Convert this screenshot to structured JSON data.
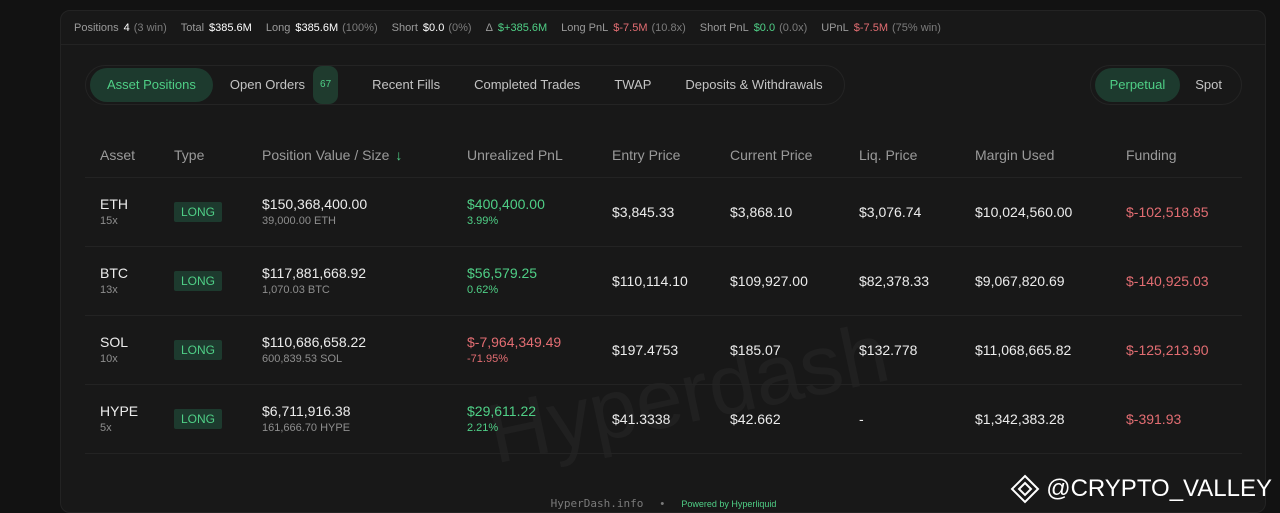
{
  "stats": [
    {
      "label": "Positions",
      "value": "4",
      "sub": "(3 win)",
      "tone": "plain"
    },
    {
      "label": "Total",
      "value": "$385.6M",
      "sub": "",
      "tone": "plain"
    },
    {
      "label": "Long",
      "value": "$385.6M",
      "sub": "(100%)",
      "tone": "plain"
    },
    {
      "label": "Short",
      "value": "$0.0",
      "sub": "(0%)",
      "tone": "plain"
    },
    {
      "label": "Δ",
      "value": "$+385.6M",
      "sub": "",
      "tone": "pos"
    },
    {
      "label": "Long PnL",
      "value": "$-7.5M",
      "sub": "(10.8x)",
      "tone": "neg"
    },
    {
      "label": "Short PnL",
      "value": "$0.0",
      "sub": "(0.0x)",
      "tone": "pos"
    },
    {
      "label": "UPnL",
      "value": "$-7.5M",
      "sub": "(75% win)",
      "tone": "neg"
    }
  ],
  "tabs": [
    {
      "label": "Asset Positions",
      "badge": "",
      "active": true
    },
    {
      "label": "Open Orders",
      "badge": "67",
      "active": false
    },
    {
      "label": "Recent Fills",
      "badge": "",
      "active": false
    },
    {
      "label": "Completed Trades",
      "badge": "",
      "active": false
    },
    {
      "label": "TWAP",
      "badge": "",
      "active": false
    },
    {
      "label": "Deposits & Withdrawals",
      "badge": "",
      "active": false
    }
  ],
  "market_toggle": [
    {
      "label": "Perpetual",
      "active": true
    },
    {
      "label": "Spot",
      "active": false
    }
  ],
  "columns": [
    "Asset",
    "Type",
    "Position Value / Size",
    "Unrealized PnL",
    "Entry Price",
    "Current Price",
    "Liq. Price",
    "Margin Used",
    "Funding"
  ],
  "sort_arrow": "↓",
  "rows": [
    {
      "asset": "ETH",
      "leverage": "15x",
      "type": "LONG",
      "value": "$150,368,400.00",
      "size": "39,000.00 ETH",
      "upnl": "$400,400.00",
      "upnl_pct": "3.99%",
      "upnl_tone": "pos",
      "entry": "$3,845.33",
      "current": "$3,868.10",
      "liq": "$3,076.74",
      "margin": "$10,024,560.00",
      "funding": "$-102,518.85"
    },
    {
      "asset": "BTC",
      "leverage": "13x",
      "type": "LONG",
      "value": "$117,881,668.92",
      "size": "1,070.03 BTC",
      "upnl": "$56,579.25",
      "upnl_pct": "0.62%",
      "upnl_tone": "pos",
      "entry": "$110,114.10",
      "current": "$109,927.00",
      "liq": "$82,378.33",
      "margin": "$9,067,820.69",
      "funding": "$-140,925.03"
    },
    {
      "asset": "SOL",
      "leverage": "10x",
      "type": "LONG",
      "value": "$110,686,658.22",
      "size": "600,839.53 SOL",
      "upnl": "$-7,964,349.49",
      "upnl_pct": "-71.95%",
      "upnl_tone": "neg",
      "entry": "$197.4753",
      "current": "$185.07",
      "liq": "$132.778",
      "margin": "$11,068,665.82",
      "funding": "$-125,213.90"
    },
    {
      "asset": "HYPE",
      "leverage": "5x",
      "type": "LONG",
      "value": "$6,711,916.38",
      "size": "161,666.70 HYPE",
      "upnl": "$29,611.22",
      "upnl_pct": "2.21%",
      "upnl_tone": "pos",
      "entry": "$41.3338",
      "current": "$42.662",
      "liq": "-",
      "margin": "$1,342,383.28",
      "funding": "$-391.93"
    }
  ],
  "footer": {
    "site": "HyperDash.info",
    "separator": "•",
    "powered": "Powered by Hyperliquid"
  },
  "watermark": "Hyperdash",
  "brand": {
    "handle": "@CRYPTO_VALLEY",
    "icon": "binance-diamond-icon"
  },
  "colors": {
    "accent_green": "#4fcf86",
    "negative_red": "#e26d72",
    "background": "#121212"
  }
}
